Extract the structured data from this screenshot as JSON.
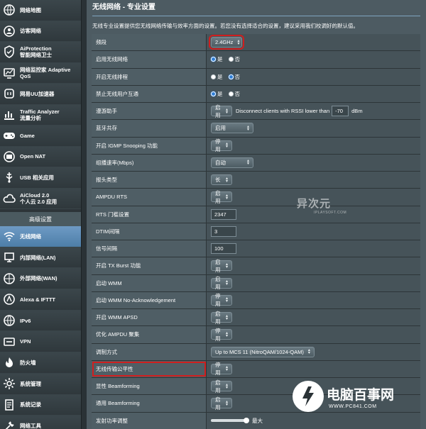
{
  "sidebar": {
    "items": [
      {
        "label": "网络地图",
        "icon": "map-icon"
      },
      {
        "label": "访客网络",
        "icon": "guests-icon"
      },
      {
        "label": "AiProtection\n智能网络卫士",
        "icon": "shield-icon"
      },
      {
        "label": "网络监控家 Adaptive\nQoS",
        "icon": "qos-icon"
      },
      {
        "label": "网易UU加速器",
        "icon": "uu-icon"
      },
      {
        "label": "Traffic Analyzer\n流量分析",
        "icon": "analyzer-icon"
      },
      {
        "label": "Game",
        "icon": "gamepad-icon"
      },
      {
        "label": "Open NAT",
        "icon": "open-nat-icon"
      },
      {
        "label": "USB 相关应用",
        "icon": "usb-icon"
      },
      {
        "label": "AiCloud 2.0\n个人云 2.0 应用",
        "icon": "cloud-icon"
      }
    ],
    "section_title": "高级设置",
    "advanced_items": [
      {
        "label": "无线网络",
        "icon": "wifi-icon"
      },
      {
        "label": "内部网络(LAN)",
        "icon": "lan-icon"
      },
      {
        "label": "外部网络(WAN)",
        "icon": "wan-icon"
      },
      {
        "label": "Alexa & IFTTT",
        "icon": "alexa-icon"
      },
      {
        "label": "IPv6",
        "icon": "ipv6-icon"
      },
      {
        "label": "VPN",
        "icon": "vpn-icon"
      },
      {
        "label": "防火墙",
        "icon": "firewall-icon"
      },
      {
        "label": "系统管理",
        "icon": "admin-icon"
      },
      {
        "label": "系统记录",
        "icon": "log-icon"
      },
      {
        "label": "网络工具",
        "icon": "tools-icon"
      }
    ]
  },
  "main": {
    "title": "无线网络 - 专业设置",
    "description": "无线专业设置提供您无线网络传输与效率方面的设置。若您没有选择适合的设置，建议采用我们校调好的默认值。",
    "rows": [
      {
        "label": "频段",
        "select": "2.4GHz"
      },
      {
        "label": "启用无线网络",
        "radio_yes": "是",
        "radio_no": "否"
      },
      {
        "label": "开启无线排程",
        "radio_yes": "是",
        "radio_no": "否"
      },
      {
        "label": "禁止无线用户互通",
        "radio_yes": "是",
        "radio_no": "否"
      },
      {
        "label": "漫游助手",
        "select": "启用",
        "text": "Disconnect clients with RSSI lower than",
        "input": "-70",
        "unit": "dBm"
      },
      {
        "label": "蓝牙共存",
        "select": "启用"
      },
      {
        "label": "开启 IGMP Snooping 功能",
        "select": "停用"
      },
      {
        "label": "组播速率(Mbps)",
        "select": "自动"
      },
      {
        "label": "报头类型",
        "select": "长"
      },
      {
        "label": "AMPDU RTS",
        "select": "启用"
      },
      {
        "label": "RTS 门槛设置",
        "input": "2347"
      },
      {
        "label": "DTIM间隔",
        "input": "3"
      },
      {
        "label": "信号间隔",
        "input": "100"
      },
      {
        "label": "开启 TX Burst 功能",
        "select": "启用"
      },
      {
        "label": "启动 WMM",
        "select": "启用"
      },
      {
        "label": "启动 WMM No-Acknowledgement",
        "select": "停用"
      },
      {
        "label": "开启 WMM APSD",
        "select": "启用"
      },
      {
        "label": "优化 AMPDU 聚集",
        "select": "停用"
      },
      {
        "label": "调制方式",
        "select": "Up to MCS 11 (NitroQAM/1024-QAM)"
      },
      {
        "label": "无线传输公平性",
        "select": "停用"
      },
      {
        "label": "显性 Beamforming",
        "select": "启用"
      },
      {
        "label": "通用 Beamforming",
        "select": "启用"
      },
      {
        "label": "发射功率调整",
        "slider_label": "最大",
        "slider_level": 1.0
      }
    ]
  },
  "watermarks": {
    "mid_big": "异次元",
    "mid_small": "IPLAYSOFT.COM",
    "bot_name": "电脑百事网",
    "bot_url": "WWW.PC841.COM"
  },
  "colors": {
    "active": "#4d7ea8",
    "highlight": "#d01f1f",
    "radio_on": "#2f7fd8"
  }
}
